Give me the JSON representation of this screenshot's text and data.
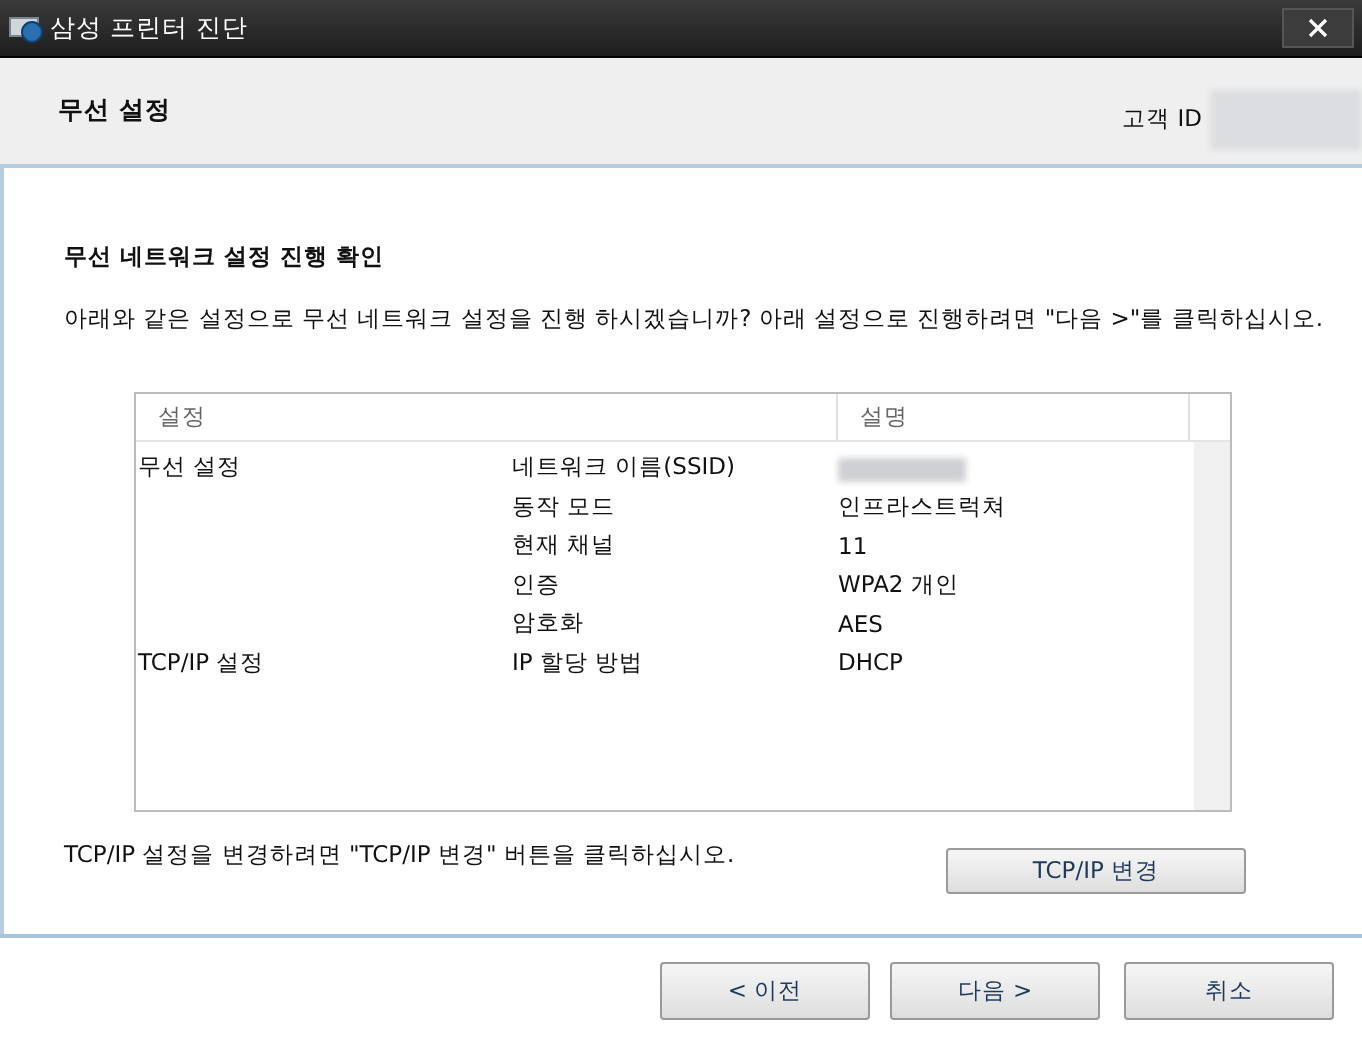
{
  "window": {
    "title": "삼성 프린터 진단"
  },
  "header": {
    "title": "무선 설정",
    "customer_id_label": "고객 ID",
    "customer_id_blurred": true
  },
  "body": {
    "heading": "무선 네트워크 설정 진행 확인",
    "intro": "아래와 같은 설정으로 무선 네트워크 설정을 진행 하시겠습니까? 아래 설정으로 진행하려면 \"다음 >\"를 클릭하십시오."
  },
  "table": {
    "columns": [
      "설정",
      "설명"
    ],
    "rows": [
      {
        "group": "무선 설정",
        "item": "네트워크 이름(SSID)",
        "kind": "blurred"
      },
      {
        "group": "",
        "item": "동작 모드",
        "kind": "text",
        "value": "인프라스트럭쳐"
      },
      {
        "group": "",
        "item": "현재 채널",
        "kind": "text",
        "value": "11"
      },
      {
        "group": "",
        "item": "인증",
        "kind": "text",
        "value": "WPA2 개인"
      },
      {
        "group": "",
        "item": "암호화",
        "kind": "text",
        "value": "AES"
      },
      {
        "group": "TCP/IP 설정",
        "item": "IP 할당 방법",
        "kind": "text",
        "value": "DHCP"
      }
    ]
  },
  "tcpip_note": "TCP/IP 설정을 변경하려면 \"TCP/IP 변경\" 버튼을 클릭하십시오.",
  "tcpip_button": "TCP/IP 변경",
  "buttons": [
    "< 이전",
    "다음 >",
    "취소"
  ]
}
